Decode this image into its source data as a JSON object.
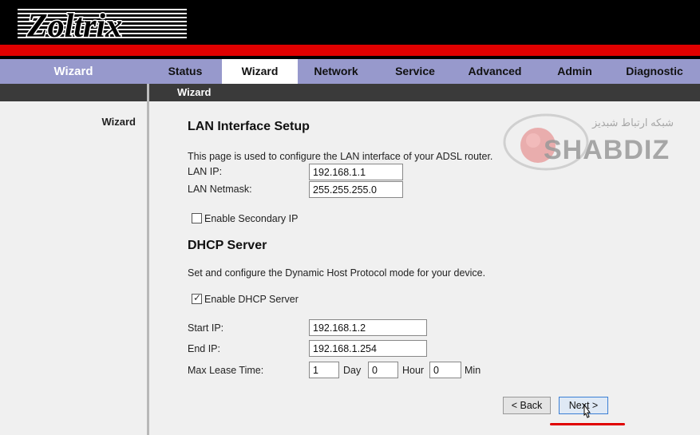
{
  "brand": {
    "logo_text": "Zoltrix"
  },
  "nav": {
    "section": "Wizard",
    "tabs": [
      {
        "label": "Status"
      },
      {
        "label": "Wizard"
      },
      {
        "label": "Network"
      },
      {
        "label": "Service"
      },
      {
        "label": "Advanced"
      },
      {
        "label": "Admin"
      },
      {
        "label": "Diagnostic"
      }
    ],
    "active_tab": "Wizard"
  },
  "subbar": {
    "label": "Wizard"
  },
  "sidebar": {
    "items": [
      {
        "label": "Wizard"
      }
    ]
  },
  "lan": {
    "title": "LAN Interface Setup",
    "description": "This page is used to configure the LAN interface of your ADSL router.",
    "ip_label": "LAN IP:",
    "ip_value": "192.168.1.1",
    "netmask_label": "LAN Netmask:",
    "netmask_value": "255.255.255.0",
    "secondary_label": "Enable Secondary IP",
    "secondary_checked": false
  },
  "dhcp": {
    "title": "DHCP Server",
    "description": "Set and configure the Dynamic Host Protocol mode for your device.",
    "enable_label": "Enable DHCP Server",
    "enable_checked": true,
    "start_label": "Start IP:",
    "start_value": "192.168.1.2",
    "end_label": "End IP:",
    "end_value": "192.168.1.254",
    "lease_label": "Max Lease Time:",
    "lease_day_value": "1",
    "day_label": "Day",
    "lease_hour_value": "0",
    "hour_label": "Hour",
    "lease_min_value": "0",
    "min_label": "Min"
  },
  "buttons": {
    "back": "< Back",
    "next": "Next >"
  },
  "watermark": {
    "text": "SHABDIZ",
    "subtext": "شبکه ارتباط شبدیز"
  },
  "colors": {
    "nav_bg": "#9799cc",
    "header_red": "#e00000",
    "header_black": "#000000",
    "subbar": "#3a3a3a"
  }
}
